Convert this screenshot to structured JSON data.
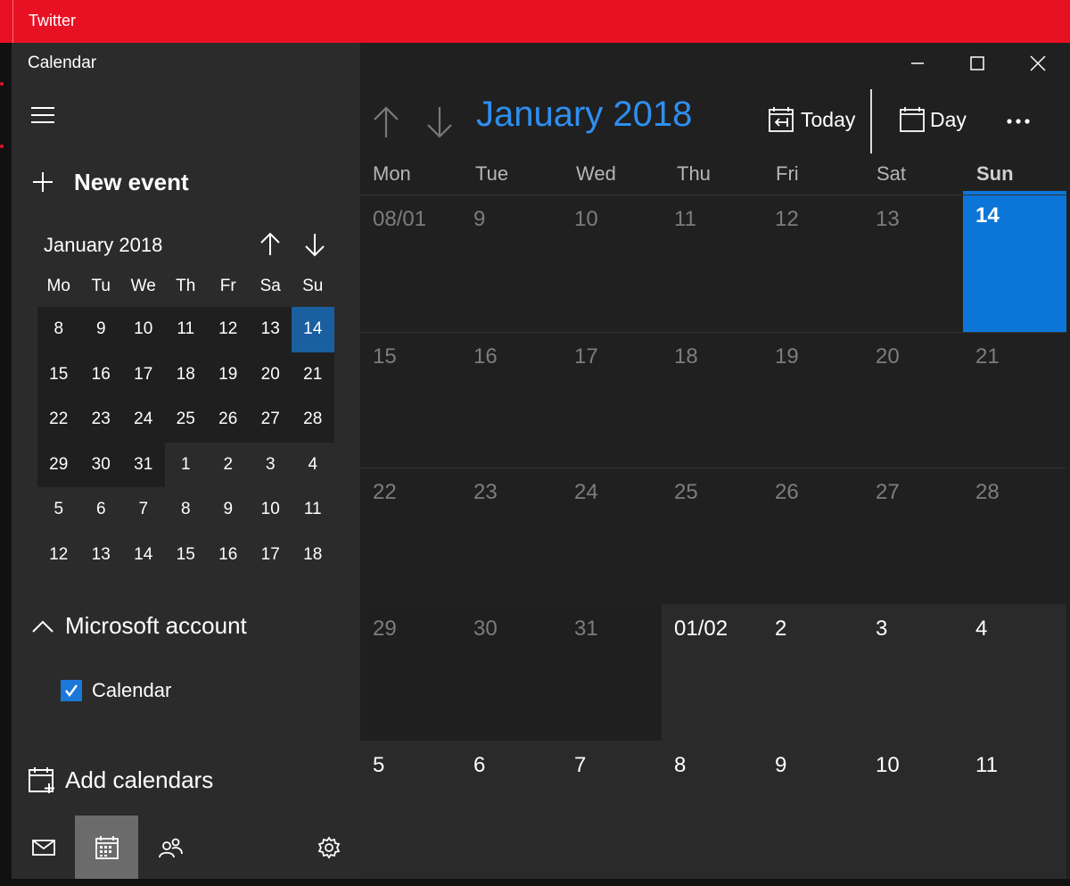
{
  "taskbar": {
    "title": "Twitter"
  },
  "app": {
    "title": "Calendar"
  },
  "sidebar": {
    "new_event_label": "New event",
    "mini_calendar": {
      "month_label": "January 2018",
      "weekdays": [
        "Mo",
        "Tu",
        "We",
        "Th",
        "Fr",
        "Sa",
        "Su"
      ],
      "weeks": [
        [
          "8",
          "9",
          "10",
          "11",
          "12",
          "13",
          "14"
        ],
        [
          "15",
          "16",
          "17",
          "18",
          "19",
          "20",
          "21"
        ],
        [
          "22",
          "23",
          "24",
          "25",
          "26",
          "27",
          "28"
        ],
        [
          "29",
          "30",
          "31",
          "1",
          "2",
          "3",
          "4"
        ],
        [
          "5",
          "6",
          "7",
          "8",
          "9",
          "10",
          "11"
        ],
        [
          "12",
          "13",
          "14",
          "15",
          "16",
          "17",
          "18"
        ]
      ],
      "selected_day": "14"
    },
    "account": {
      "name": "Microsoft account",
      "calendars": [
        {
          "label": "Calendar",
          "checked": true
        }
      ]
    },
    "add_calendars_label": "Add calendars",
    "bottom_nav": [
      {
        "icon": "mail-icon"
      },
      {
        "icon": "calendar-icon",
        "active": true
      },
      {
        "icon": "people-icon"
      },
      {
        "icon": "settings-icon"
      }
    ]
  },
  "main": {
    "month_title": "January 2018",
    "today_label": "Today",
    "view_label": "Day",
    "more_label": "•••",
    "weekdays": [
      "Mon",
      "Tue",
      "Wed",
      "Thu",
      "Fri",
      "Sat",
      "Sun"
    ],
    "weeks": [
      [
        "08/01",
        "9",
        "10",
        "11",
        "12",
        "13",
        "14"
      ],
      [
        "15",
        "16",
        "17",
        "18",
        "19",
        "20",
        "21"
      ],
      [
        "22",
        "23",
        "24",
        "25",
        "26",
        "27",
        "28"
      ],
      [
        "29",
        "30",
        "31",
        "01/02",
        "2",
        "3",
        "4"
      ],
      [
        "5",
        "6",
        "7",
        "8",
        "9",
        "10",
        "11"
      ]
    ],
    "today": "14"
  },
  "colors": {
    "accent": "#0b76d8",
    "title_accent": "#2e8ff0",
    "taskbar": "#e81123",
    "sidebar_bg": "#2b2b2b",
    "main_bg": "#202020"
  }
}
